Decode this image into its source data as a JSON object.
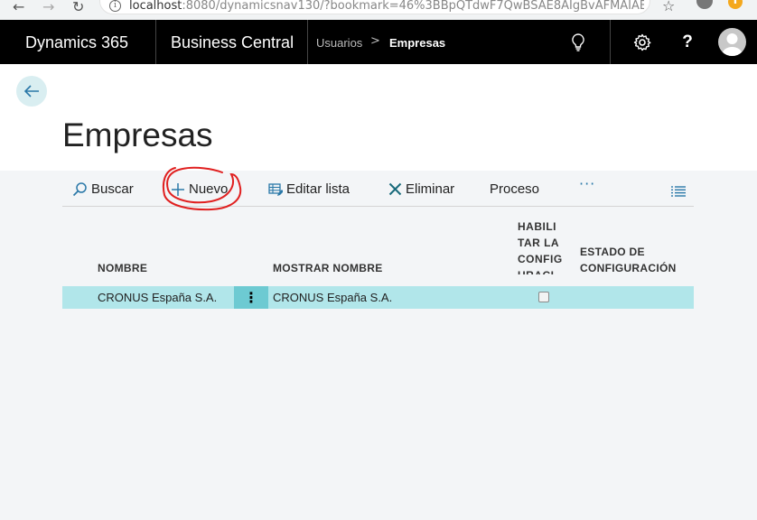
{
  "browser": {
    "url_host": "localhost",
    "url_rest": ":8080/dynamicsnav130/?bookmark=46%3BBpQTdwF7QwBSAE8AIgBvAFMAIABFA...",
    "nav_back": "←",
    "nav_forward": "→",
    "nav_reload": "↻",
    "info_glyph": "i",
    "star_glyph": "☆"
  },
  "appbar": {
    "product": "Dynamics 365",
    "app": "Business Central",
    "breadcrumb_parent": "Usuarios",
    "breadcrumb_sep": ">",
    "breadcrumb_current": "Empresas",
    "help_label": "?",
    "icons": [
      "lightbulb-icon",
      "gear-icon",
      "help-icon",
      "avatar-icon"
    ]
  },
  "page": {
    "title": "Empresas"
  },
  "actions": {
    "search": "Buscar",
    "new": "Nuevo",
    "edit_list": "Editar lista",
    "delete": "Eliminar",
    "process": "Proceso",
    "more": "···"
  },
  "table": {
    "headers": {
      "name": "NOMBRE",
      "display_name": "MOSTRAR NOMBRE",
      "enabled": "HABILITAR LA CONFIGURACIÓN DE LA...",
      "config_state": "ESTADO DE CONFIGURACIÓN"
    },
    "rows": [
      {
        "name": "CRONUS España S.A.",
        "display_name": "CRONUS España S.A.",
        "enabled": false,
        "config_state": "",
        "menu_glyph": "⋮"
      }
    ]
  },
  "colors": {
    "appbar_bg": "#000000",
    "selected_row": "#b1e6ea",
    "row_menu": "#6dcad2",
    "accent": "#2a78a8",
    "annotation": "#e02020"
  }
}
